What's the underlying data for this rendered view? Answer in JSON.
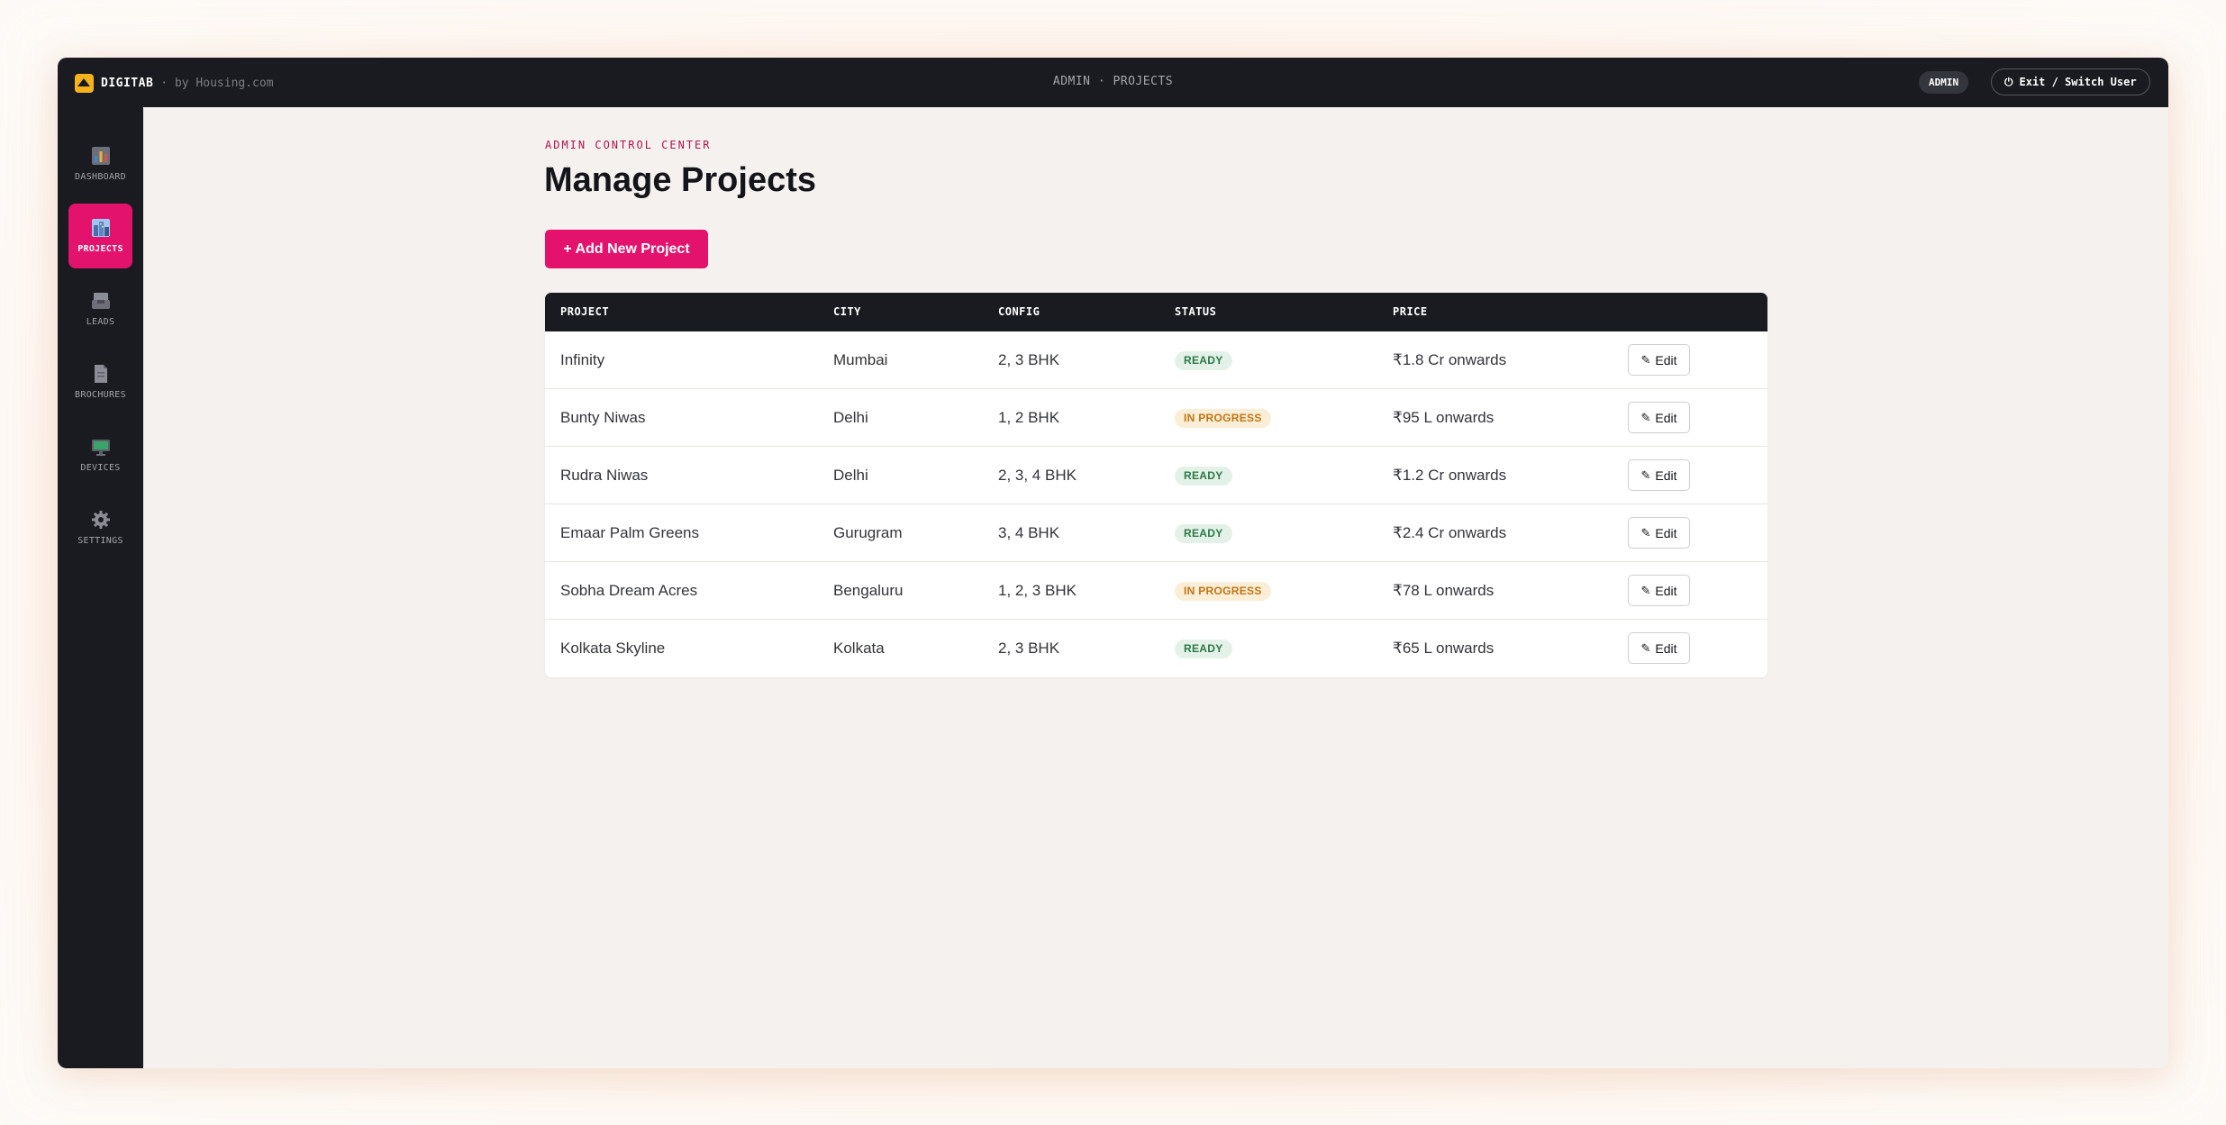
{
  "brand": {
    "name": "DIGITAB",
    "tagline": "· by Housing.com",
    "logo_icon": "house-icon"
  },
  "breadcrumb": "ADMIN · PROJECTS",
  "user": {
    "role": "ADMIN",
    "exit_label": "Exit / Switch User"
  },
  "colors": {
    "accent": "#e3126d",
    "dark": "#1a1b20",
    "background": "#f5f1ee",
    "ready": "#2a7a46",
    "in_progress": "#c07513"
  },
  "sidebar": {
    "items": [
      {
        "label": "DASHBOARD",
        "icon": "bar-chart-icon",
        "active": false
      },
      {
        "label": "PROJECTS",
        "icon": "cityscape-icon",
        "active": true
      },
      {
        "label": "LEADS",
        "icon": "inbox-tray-icon",
        "active": false
      },
      {
        "label": "BROCHURES",
        "icon": "document-icon",
        "active": false
      },
      {
        "label": "DEVICES",
        "icon": "monitor-icon",
        "active": false
      },
      {
        "label": "SETTINGS",
        "icon": "gear-icon",
        "active": false
      }
    ]
  },
  "main": {
    "eyebrow": "ADMIN CONTROL CENTER",
    "title": "Manage Projects",
    "add_button": "+ Add New Project"
  },
  "table": {
    "headers": [
      "PROJECT",
      "CITY",
      "CONFIG",
      "STATUS",
      "PRICE"
    ],
    "edit_label": "Edit",
    "rows": [
      {
        "project": "Infinity",
        "city": "Mumbai",
        "config": "2, 3 BHK",
        "status": "READY",
        "price": "₹1.8 Cr onwards"
      },
      {
        "project": "Bunty Niwas",
        "city": "Delhi",
        "config": "1, 2 BHK",
        "status": "IN PROGRESS",
        "price": "₹95 L onwards"
      },
      {
        "project": "Rudra Niwas",
        "city": "Delhi",
        "config": "2, 3, 4 BHK",
        "status": "READY",
        "price": "₹1.2 Cr onwards"
      },
      {
        "project": "Emaar Palm Greens",
        "city": "Gurugram",
        "config": "3, 4 BHK",
        "status": "READY",
        "price": "₹2.4 Cr onwards"
      },
      {
        "project": "Sobha Dream Acres",
        "city": "Bengaluru",
        "config": "1, 2, 3 BHK",
        "status": "IN PROGRESS",
        "price": "₹78 L onwards"
      },
      {
        "project": "Kolkata Skyline",
        "city": "Kolkata",
        "config": "2, 3 BHK",
        "status": "READY",
        "price": "₹65 L onwards"
      }
    ]
  }
}
